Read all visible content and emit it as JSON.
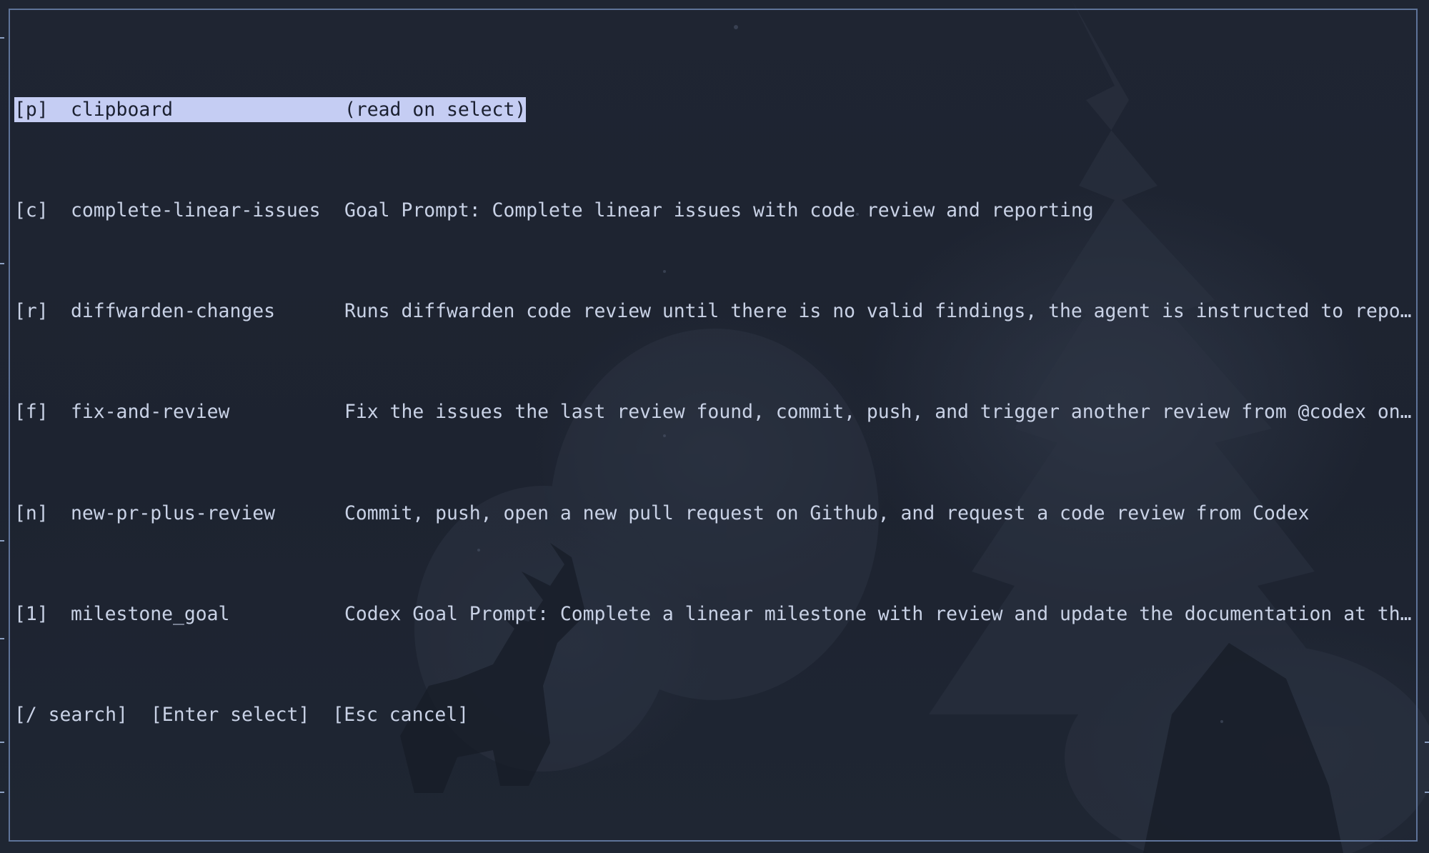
{
  "picker": {
    "items": [
      {
        "key": "[p]",
        "name": "clipboard",
        "description": "(read on select)",
        "selected": true
      },
      {
        "key": "[c]",
        "name": "complete-linear-issues",
        "description": "Goal Prompt: Complete linear issues with code review and reporting",
        "selected": false
      },
      {
        "key": "[r]",
        "name": "diffwarden-changes",
        "description": "Runs diffwarden code review until there is no valid findings, the agent is instructed to repo…",
        "selected": false
      },
      {
        "key": "[f]",
        "name": "fix-and-review",
        "description": "Fix the issues the last review found, commit, push, and trigger another review from @codex on…",
        "selected": false
      },
      {
        "key": "[n]",
        "name": "new-pr-plus-review",
        "description": "Commit, push, open a new pull request on Github, and request a code review from Codex",
        "selected": false
      },
      {
        "key": "[1]",
        "name": "milestone_goal",
        "description": "Codex Goal Prompt: Complete a linear milestone with review and update the documentation at th…",
        "selected": false
      }
    ],
    "hints": {
      "search": "[/ search]",
      "enter": "[Enter select]",
      "escape": "[Esc cancel]"
    }
  },
  "colors": {
    "background": "#1e2431",
    "frame_border": "#5e7399",
    "text": "#c9d2e6",
    "selection_bg": "#c5cdf3",
    "selection_text": "#1b2030"
  }
}
